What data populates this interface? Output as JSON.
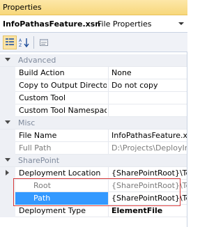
{
  "window": {
    "title": "Properties"
  },
  "object": {
    "name": "InfoPathasFeature.xsn",
    "kind": "File Properties"
  },
  "toolbar": {
    "buttons": [
      {
        "name": "categorized-icon",
        "active": true
      },
      {
        "name": "alphabetical-icon",
        "active": false
      },
      {
        "name": "property-pages-icon",
        "active": false
      }
    ]
  },
  "grid": {
    "categories": {
      "advanced": "Advanced",
      "misc": "Misc",
      "sharepoint": "SharePoint"
    },
    "rows": {
      "build_action": {
        "label": "Build Action",
        "value": "None"
      },
      "copy_output": {
        "label": "Copy to Output Director",
        "value": "Do not copy"
      },
      "custom_tool": {
        "label": "Custom Tool",
        "value": ""
      },
      "custom_tool_ns": {
        "label": "Custom Tool Namespac",
        "value": ""
      },
      "file_name": {
        "label": "File Name",
        "value": "InfoPathasFeature.xs"
      },
      "full_path": {
        "label": "Full Path",
        "value": "D:\\Projects\\DeployIn"
      },
      "deploy_location": {
        "label": "Deployment Location",
        "value": "{SharePointRoot}\\Te"
      },
      "root": {
        "label": "Root",
        "value": "{SharePointRoot}\\Te"
      },
      "path": {
        "label": "Path",
        "value": "{SharePointRoot}\\Te"
      },
      "deploy_type": {
        "label": "Deployment Type",
        "value": "ElementFile"
      }
    }
  },
  "colors": {
    "selection": "#3399ff",
    "highlight_border": "#d83a3a"
  }
}
